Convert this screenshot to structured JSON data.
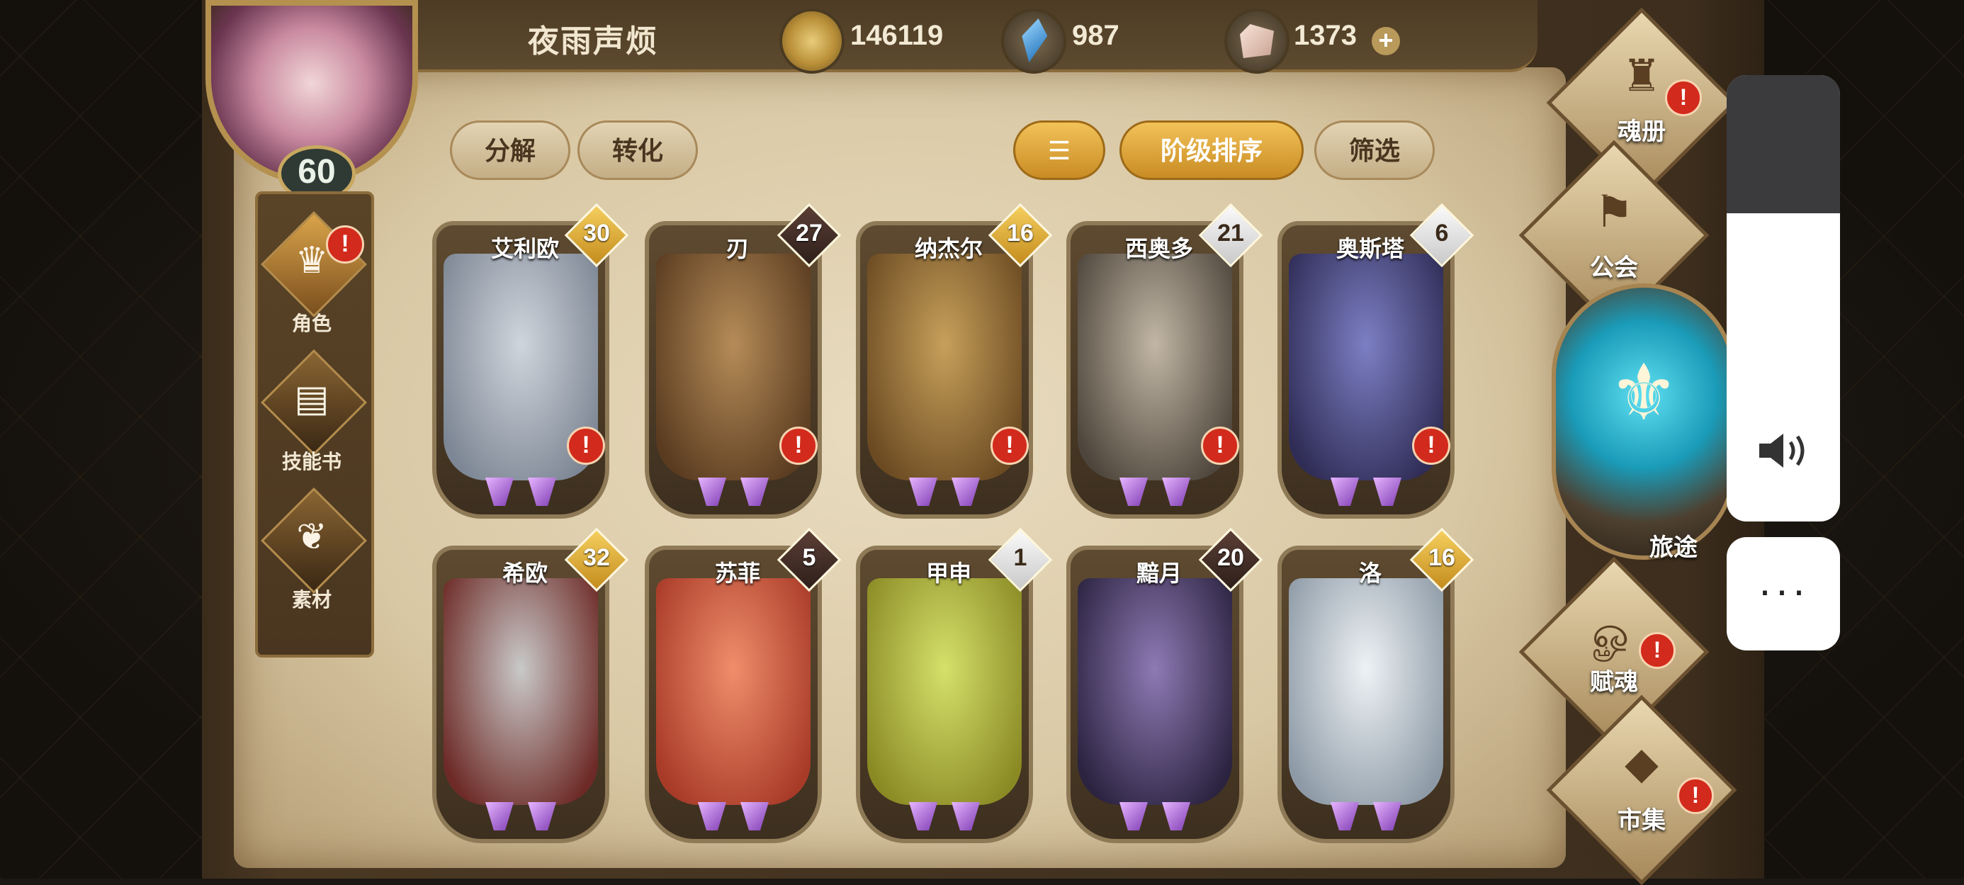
{
  "header": {
    "player_name": "夜雨声烦",
    "gold": "146119",
    "gems": "987",
    "crystals": "1373",
    "plus": "+"
  },
  "player": {
    "level": "60"
  },
  "side_menu": [
    {
      "label": "角色",
      "icon": "character-icon",
      "active": true,
      "alert": "!"
    },
    {
      "label": "技能书",
      "icon": "skill-book-icon",
      "active": false
    },
    {
      "label": "素材",
      "icon": "material-icon",
      "active": false
    }
  ],
  "toolbar": {
    "decompose": "分解",
    "convert": "转化",
    "sort_icon": "sort-icon",
    "tier_sort": "阶级排序",
    "filter": "筛选"
  },
  "heroes": [
    {
      "name": "艾利欧",
      "level": "30",
      "tag": "gold",
      "alert": "!",
      "art": [
        "#cfd5dc",
        "#7d8694"
      ]
    },
    {
      "name": "刃",
      "level": "27",
      "tag": "dark",
      "alert": "!",
      "art": [
        "#b58c58",
        "#5a3b20"
      ]
    },
    {
      "name": "纳杰尔",
      "level": "16",
      "tag": "gold",
      "alert": "!",
      "art": [
        "#c6a05a",
        "#6b4a22"
      ]
    },
    {
      "name": "西奥多",
      "level": "21",
      "tag": "white",
      "alert": "!",
      "art": [
        "#c2b7a6",
        "#4e463c"
      ]
    },
    {
      "name": "奥斯塔",
      "level": "6",
      "tag": "white",
      "alert": "!",
      "art": [
        "#7c7fc4",
        "#2f2c55"
      ]
    },
    {
      "name": "希欧",
      "level": "32",
      "tag": "gold",
      "art": [
        "#c9c9c9",
        "#6d2a26"
      ]
    },
    {
      "name": "苏菲",
      "level": "5",
      "tag": "dark",
      "art": [
        "#f08d6a",
        "#a83a28"
      ]
    },
    {
      "name": "甲申",
      "level": "1",
      "tag": "white",
      "art": [
        "#d5e06a",
        "#8a8a24"
      ]
    },
    {
      "name": "黯月",
      "level": "20",
      "tag": "dark",
      "art": [
        "#8e7ab4",
        "#2b2340"
      ]
    },
    {
      "name": "洛",
      "level": "16",
      "tag": "gold",
      "art": [
        "#eef2f5",
        "#8d9aa6"
      ]
    }
  ],
  "nav": {
    "soul_book": "魂册",
    "guild": "公会",
    "journey": "旅途",
    "soul_endow": "赋魂",
    "market": "市集",
    "alert": "!"
  },
  "overlay": {
    "more": "···",
    "volume_level": 0.69
  }
}
